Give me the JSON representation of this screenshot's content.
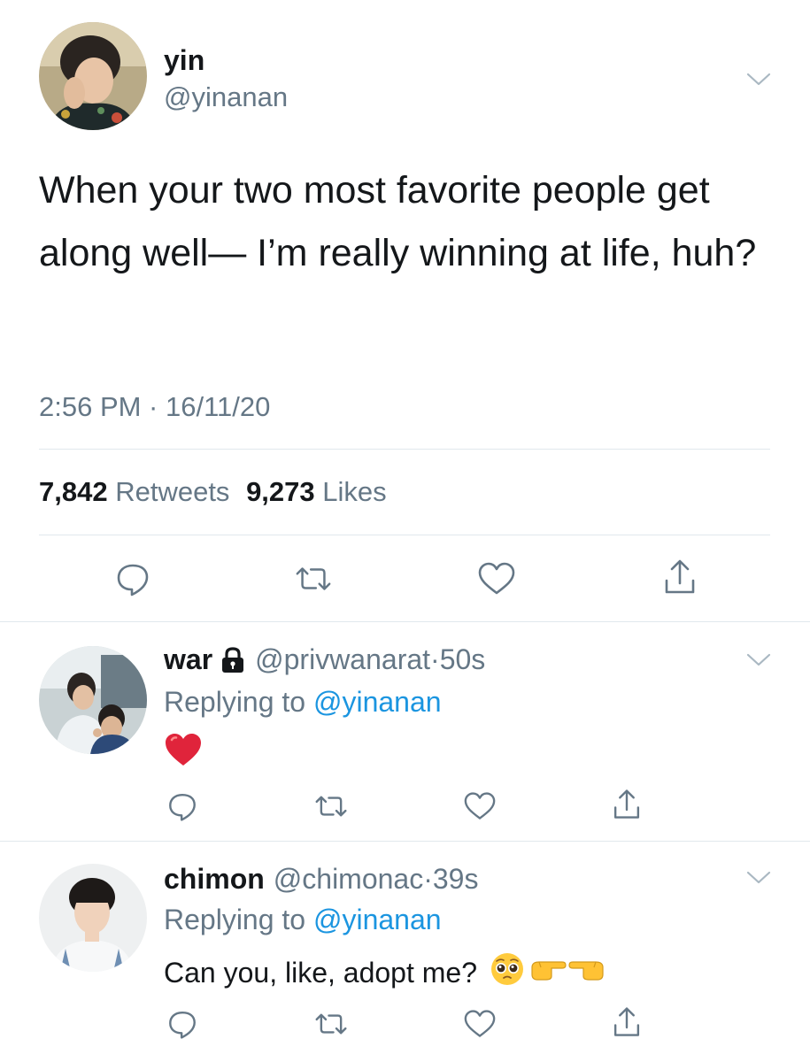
{
  "main_tweet": {
    "name": "yin",
    "handle": "@yinanan",
    "text": "When your two most favorite people get along well— I’m really winning at life, huh?",
    "timestamp": "2:56 PM · 16/11/20",
    "retweets_count": "7,842",
    "retweets_label": "Retweets",
    "likes_count": "9,273",
    "likes_label": "Likes"
  },
  "replies": [
    {
      "name": "war",
      "locked": true,
      "handle_time": "@privwanarat·50s",
      "replying_prefix": "Replying to",
      "replying_to": "@yinanan",
      "text": ""
    },
    {
      "name": "chimon",
      "locked": false,
      "handle_time": "@chimonac·39s",
      "replying_prefix": "Replying to",
      "replying_to": "@yinanan",
      "text": "Can you, like, adopt me?"
    }
  ],
  "icons": {
    "actions": [
      "reply-icon",
      "retweet-icon",
      "like-icon",
      "share-icon"
    ],
    "caret": "chevron-down-icon",
    "lock": "lock-icon",
    "emojis_reply1": [
      "red-heart-emoji"
    ],
    "emojis_reply2": [
      "pleading-face-emoji",
      "pointing-right-emoji",
      "pointing-left-emoji"
    ]
  },
  "colors": {
    "text": "#14171a",
    "secondary": "#657786",
    "link": "#1b95e0",
    "divider": "#e1e8ed",
    "heart": "#e0245e"
  }
}
